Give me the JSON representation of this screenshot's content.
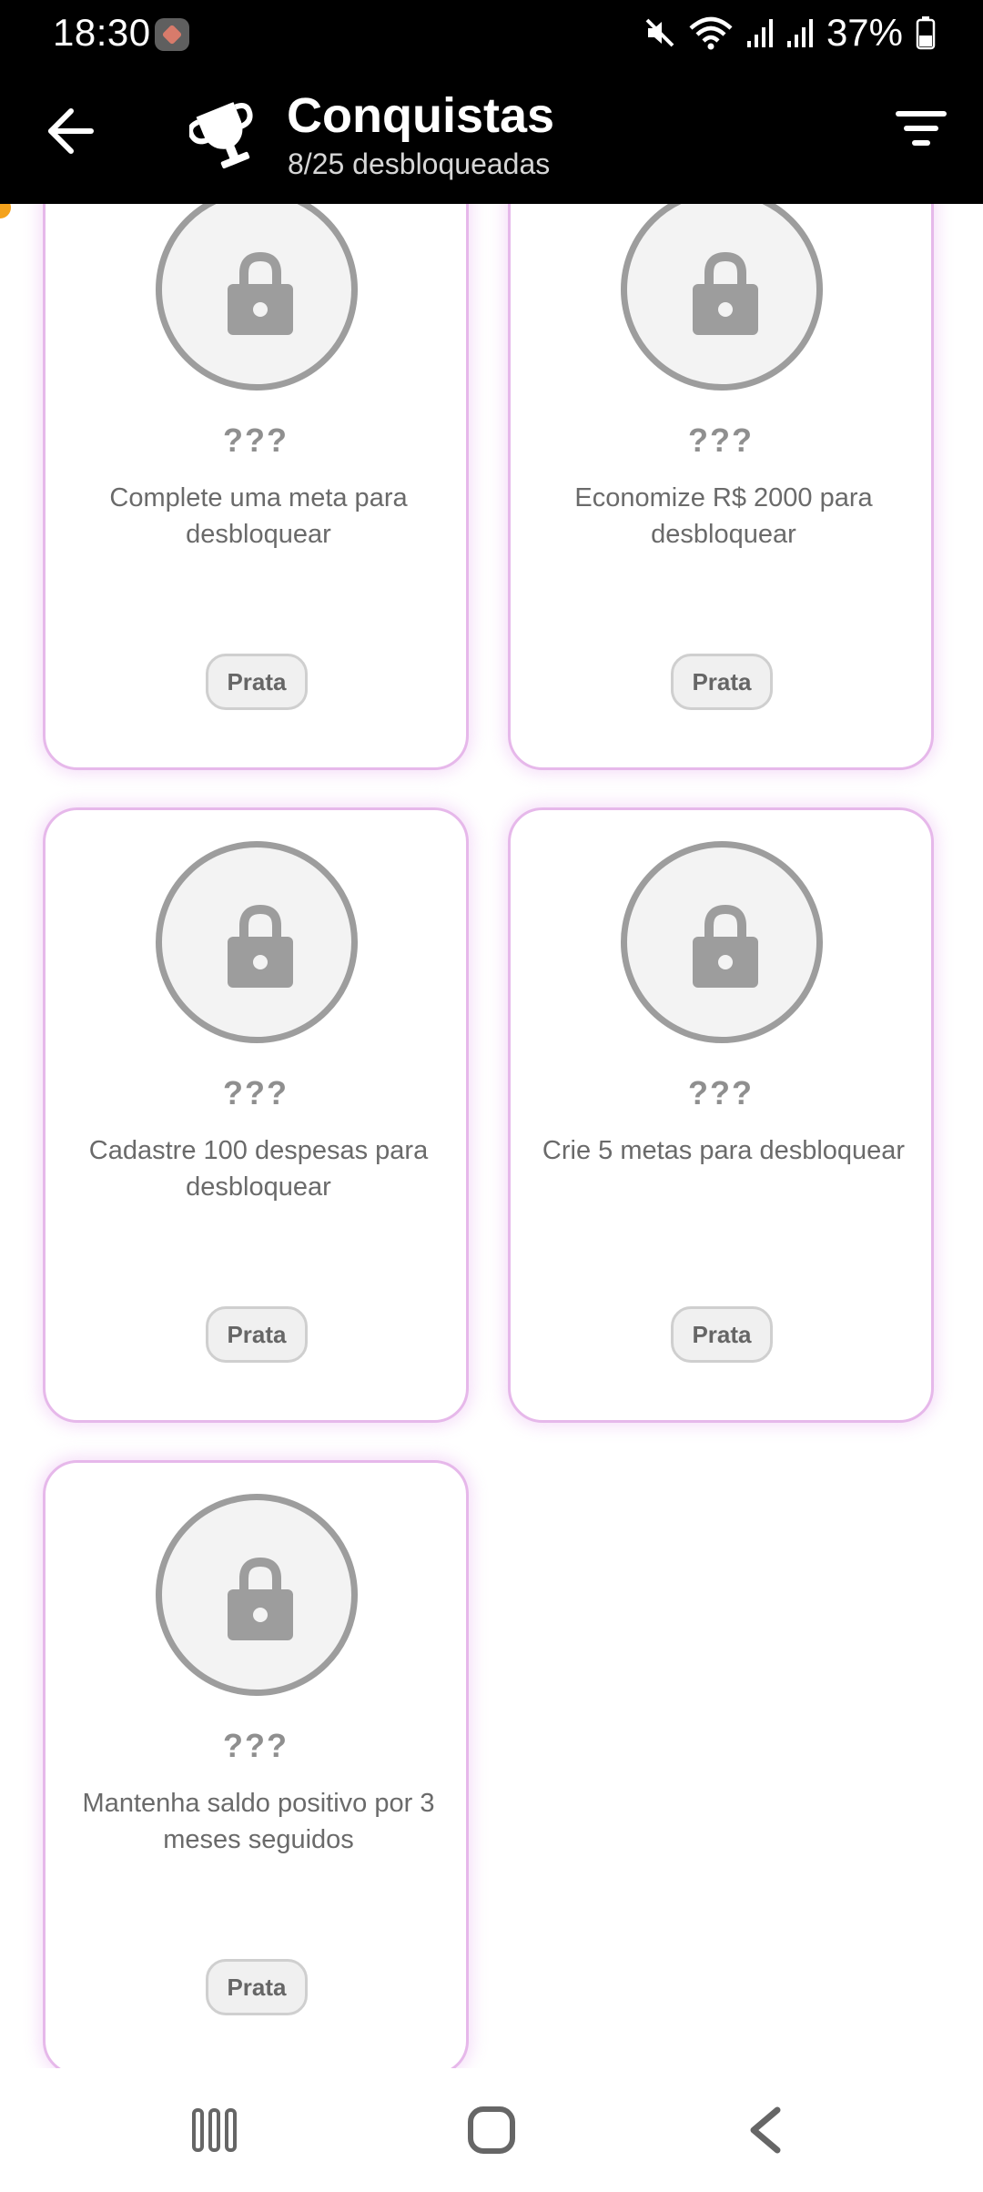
{
  "status_bar": {
    "time": "18:30",
    "battery_percent": "37%",
    "icons": [
      "app-notification-icon",
      "mute-icon",
      "wifi-icon",
      "signal-icon",
      "signal-icon",
      "battery-icon"
    ]
  },
  "app_bar": {
    "title": "Conquistas",
    "subtitle": "8/25 desbloqueadas",
    "icons": [
      "back-arrow-icon",
      "trophy-icon",
      "filter-icon"
    ]
  },
  "cards": [
    {
      "name": "???",
      "description": "Complete uma meta para desbloquear",
      "tier": "Prata",
      "locked": true
    },
    {
      "name": "???",
      "description": "Economize R$ 2000 para desbloquear",
      "tier": "Prata",
      "locked": true
    },
    {
      "name": "???",
      "description": "Cadastre 100 despesas para desbloquear",
      "tier": "Prata",
      "locked": true
    },
    {
      "name": "???",
      "description": "Crie 5 metas para desbloquear",
      "tier": "Prata",
      "locked": true
    },
    {
      "name": "???",
      "description": "Mantenha saldo positivo por 3 meses seguidos",
      "tier": "Prata",
      "locked": true
    }
  ],
  "nav_bar": {
    "buttons": [
      "recent-apps-icon",
      "home-icon",
      "system-back-icon"
    ]
  },
  "colors": {
    "app_bar_bg": "#000000",
    "card_border": "#e6b8ea",
    "lock_gray": "#9d9d9d",
    "text_gray": "#6a6a6a"
  }
}
